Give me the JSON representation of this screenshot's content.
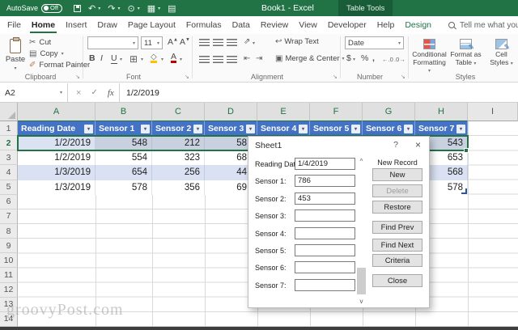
{
  "colors": {
    "excel_green": "#217346",
    "contextual_green": "#185c38",
    "table_header_blue": "#4472c4",
    "band_blue": "#d9e1f2",
    "selection_fill": "#c9d1e0",
    "gridline": "#d9d9d9"
  },
  "glyphs": {
    "caret": "▾",
    "launcher": "↘",
    "undo": "↶",
    "redo": "↷",
    "touch": "⊙",
    "table": "▦",
    "form": "▤",
    "cut": "✂",
    "format_painter": "✐",
    "borders": "⊞",
    "fill": "◇",
    "merge": "▣",
    "wrap": "↩",
    "orient": "⇗",
    "indent_dec": "⇤",
    "indent_inc": "⇥",
    "decimal_inc": "←.0",
    "decimal_dec": ".0→",
    "scroll_up": "^",
    "scroll_down": "v",
    "filter": "▾"
  },
  "titlebar": {
    "autosave_label": "AutoSave",
    "autosave_state": "Off",
    "title": "Book1 - Excel",
    "contextual_tab": "Table Tools"
  },
  "tabs": {
    "items": [
      {
        "label": "File"
      },
      {
        "label": "Home",
        "active": true
      },
      {
        "label": "Insert"
      },
      {
        "label": "Draw"
      },
      {
        "label": "Page Layout"
      },
      {
        "label": "Formulas"
      },
      {
        "label": "Data"
      },
      {
        "label": "Review"
      },
      {
        "label": "View"
      },
      {
        "label": "Developer"
      },
      {
        "label": "Help"
      },
      {
        "label": "Design",
        "accent": true
      }
    ],
    "search_placeholder": "Tell me what you want to do"
  },
  "ribbon": {
    "clipboard": {
      "group_label": "Clipboard",
      "paste_label": "Paste",
      "cut_label": "Cut",
      "copy_label": "Copy",
      "format_painter_label": "Format Painter"
    },
    "font": {
      "group_label": "Font",
      "font_name": "",
      "font_size": "11",
      "bold": "B",
      "italic": "I",
      "underline": "U",
      "grow": "A",
      "shrink": "A",
      "color_a": "A"
    },
    "alignment": {
      "group_label": "Alignment",
      "wrap_text_label": "Wrap Text",
      "merge_center_label": "Merge & Center"
    },
    "number": {
      "group_label": "Number",
      "format_value": "Date",
      "currency": "$",
      "percent": "%",
      "comma": ","
    },
    "styles": {
      "group_label": "Styles",
      "conditional_line1": "Conditional",
      "conditional_line2": "Formatting",
      "format_table_line1": "Format as",
      "format_table_line2": "Table",
      "cell_styles_line1": "Cell",
      "cell_styles_line2": "Styles"
    }
  },
  "formula_bar": {
    "name_box": "A2",
    "cancel": "×",
    "enter": "✓",
    "fx": "fx",
    "value": "1/2/2019"
  },
  "grid": {
    "column_headers": [
      "A",
      "B",
      "C",
      "D",
      "E",
      "F",
      "G",
      "H",
      "I"
    ],
    "row_numbers": [
      "1",
      "2",
      "3",
      "4",
      "5",
      "6",
      "7",
      "8",
      "9",
      "10",
      "11",
      "12",
      "13",
      "14"
    ],
    "table_headers": [
      "Reading Date",
      "Sensor 1",
      "Sensor 2",
      "Sensor 3",
      "Sensor 4",
      "Sensor 5",
      "Sensor 6",
      "Sensor 7"
    ],
    "rows": [
      {
        "cells": [
          "1/2/2019",
          "548",
          "212",
          "58",
          "",
          "",
          "",
          "543"
        ]
      },
      {
        "cells": [
          "1/2/2019",
          "554",
          "323",
          "68",
          "",
          "",
          "",
          "653"
        ]
      },
      {
        "cells": [
          "1/3/2019",
          "654",
          "256",
          "44",
          "",
          "",
          "",
          "568"
        ]
      },
      {
        "cells": [
          "1/3/2019",
          "578",
          "356",
          "69",
          "",
          "",
          "",
          "578"
        ]
      }
    ]
  },
  "dialog": {
    "title": "Sheet1",
    "help_button": "?",
    "close_button": "×",
    "record_indicator": "New Record",
    "fields": [
      {
        "label": "Reading Date:",
        "value": "1/4/2019"
      },
      {
        "label": "Sensor 1:",
        "value": "786"
      },
      {
        "label": "Sensor 2:",
        "value": "453"
      },
      {
        "label": "Sensor 3:",
        "value": ""
      },
      {
        "label": "Sensor 4:",
        "value": ""
      },
      {
        "label": "Sensor 5:",
        "value": ""
      },
      {
        "label": "Sensor 6:",
        "value": ""
      },
      {
        "label": "Sensor 7:",
        "value": ""
      }
    ],
    "buttons": [
      {
        "label": "New"
      },
      {
        "label": "Delete",
        "disabled": true
      },
      {
        "label": "Restore"
      },
      {
        "label": "Find Prev"
      },
      {
        "label": "Find Next"
      },
      {
        "label": "Criteria"
      },
      {
        "label": "Close"
      }
    ]
  },
  "watermark": "groovyPost.com"
}
